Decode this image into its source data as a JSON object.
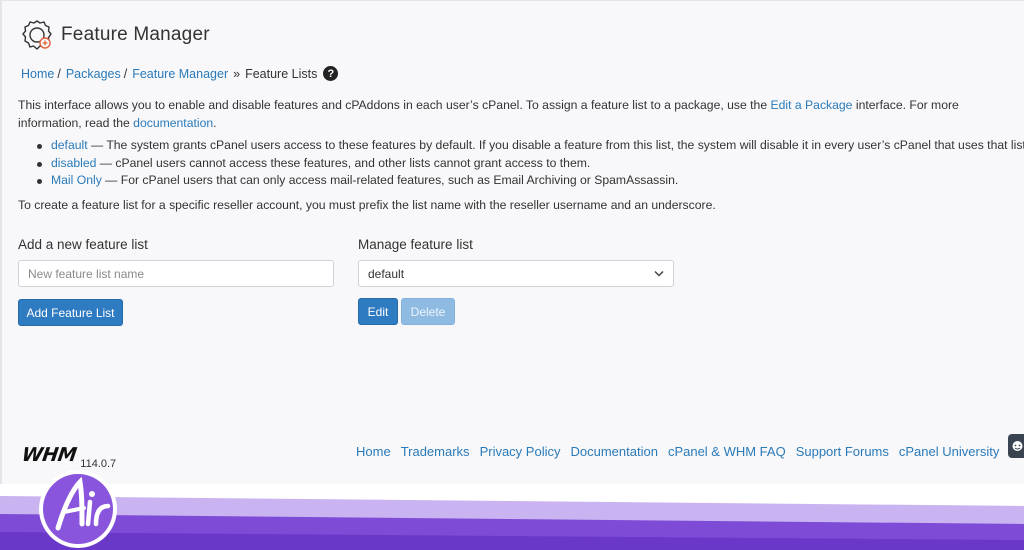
{
  "page": {
    "title": "Feature Manager",
    "breadcrumb": {
      "home": "Home",
      "packages": "Packages",
      "feature_manager": "Feature Manager",
      "separator": "/",
      "chevron": "»",
      "current": "Feature Lists"
    },
    "help_glyph": "?"
  },
  "intro": {
    "text1": "This interface allows you to enable and disable features and cPAddons in each user’s cPanel. To assign a feature list to a package, use the ",
    "edit_package_link": "Edit a Package",
    "text2": " interface. For more information, read the ",
    "documentation_link": "documentation",
    "text3": "."
  },
  "bullets": [
    {
      "link": "default",
      "text": " — The system grants cPanel users access to these features by default. If you disable a feature from this list, the system will disable it in every user’s cPanel that uses that list."
    },
    {
      "link": "disabled",
      "text": " — cPanel users cannot access these features, and other lists cannot grant access to them."
    },
    {
      "link": "Mail Only",
      "text": " — For cPanel users that can only access mail-related features, such as Email Archiving or SpamAssassin."
    }
  ],
  "prefix_note": "To create a feature list for a specific reseller account, you must prefix the list name with the reseller username and an underscore.",
  "add_section": {
    "title": "Add a new feature list",
    "input_placeholder": "New feature list name",
    "input_value": "",
    "button_label": "Add Feature List"
  },
  "manage_section": {
    "title": "Manage feature list",
    "selected": "default",
    "edit_label": "Edit",
    "delete_label": "Delete"
  },
  "footer": {
    "logo_text": "WHM",
    "version": "114.0.7",
    "links": [
      "Home",
      "Trademarks",
      "Privacy Policy",
      "Documentation",
      "cPanel & WHM FAQ",
      "Support Forums",
      "cPanel University"
    ]
  },
  "colors": {
    "link": "#2a7ab9",
    "primary_button": "#2f7bc1",
    "disabled_button": "#8fbbe3",
    "brand_purple": "#7d4bd6",
    "brand_lavender": "#c9b3f0"
  },
  "icons": {
    "app_icon": "feature-manager-gear-icon",
    "help": "question-circle-icon",
    "select_chevron": "chevron-down-icon",
    "chat": "chat-bubble-icon",
    "brand": "air-logo"
  }
}
